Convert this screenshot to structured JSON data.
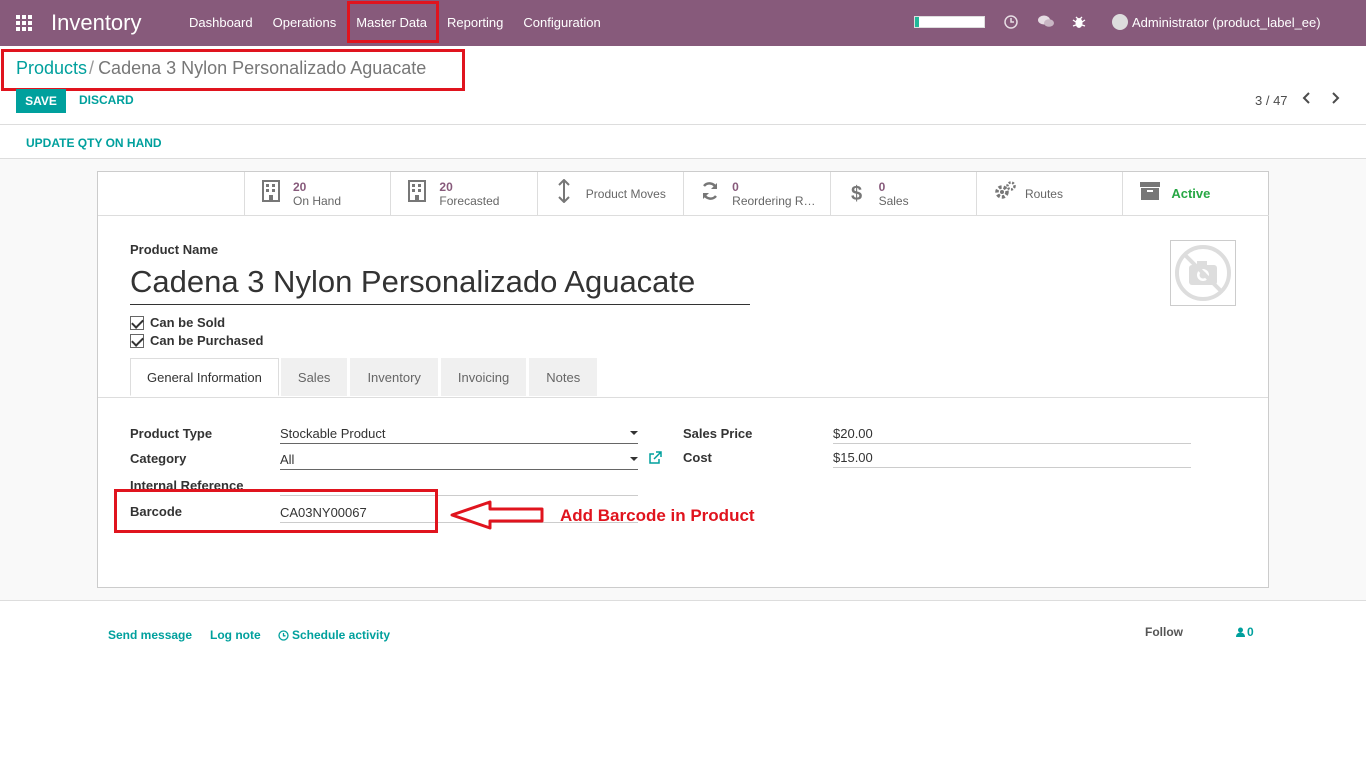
{
  "navbar": {
    "app_title": "Inventory",
    "menu": [
      "Dashboard",
      "Operations",
      "Master Data",
      "Reporting",
      "Configuration"
    ],
    "user": "Administrator (product_label_ee)",
    "color": "#875a7b"
  },
  "breadcrumb": {
    "parent": "Products",
    "separator": "/",
    "current": "Cadena 3 Nylon Personalizado Aguacate"
  },
  "actions": {
    "save": "SAVE",
    "discard": "DISCARD",
    "update_qty": "UPDATE QTY ON HAND"
  },
  "pager": {
    "value": "3 / 47"
  },
  "smart_buttons": [
    {
      "num": "20",
      "label": "On Hand",
      "icon": "building-icon"
    },
    {
      "num": "20",
      "label": "Forecasted",
      "icon": "building-icon"
    },
    {
      "num": "",
      "label": "Product Moves",
      "icon": "arrows-v-icon"
    },
    {
      "num": "0",
      "label": "Reordering Rul...",
      "icon": "refresh-icon"
    },
    {
      "num": "0",
      "label": "Sales",
      "icon": "dollar-icon"
    },
    {
      "num": "",
      "label": "Routes",
      "icon": "gears-icon"
    },
    {
      "num": "",
      "label": "Active",
      "icon": "archive-icon"
    }
  ],
  "product": {
    "name_label": "Product Name",
    "name": "Cadena 3 Nylon Personalizado Aguacate",
    "can_be_sold": "Can be Sold",
    "can_be_purchased": "Can be Purchased"
  },
  "tabs": [
    "General Information",
    "Sales",
    "Inventory",
    "Invoicing",
    "Notes"
  ],
  "general": {
    "product_type_label": "Product Type",
    "product_type": "Stockable Product",
    "category_label": "Category",
    "category": "All",
    "internal_ref_label": "Internal Reference",
    "internal_ref": "",
    "barcode_label": "Barcode",
    "barcode": "CA03NY00067",
    "sales_price_label": "Sales Price",
    "sales_price": "$20.00",
    "cost_label": "Cost",
    "cost": "$15.00"
  },
  "annotation": {
    "text": "Add Barcode in Product"
  },
  "chatter": {
    "send_message": "Send message",
    "log_note": "Log note",
    "schedule_activity": "Schedule activity",
    "follow": "Follow",
    "followers": "0"
  }
}
